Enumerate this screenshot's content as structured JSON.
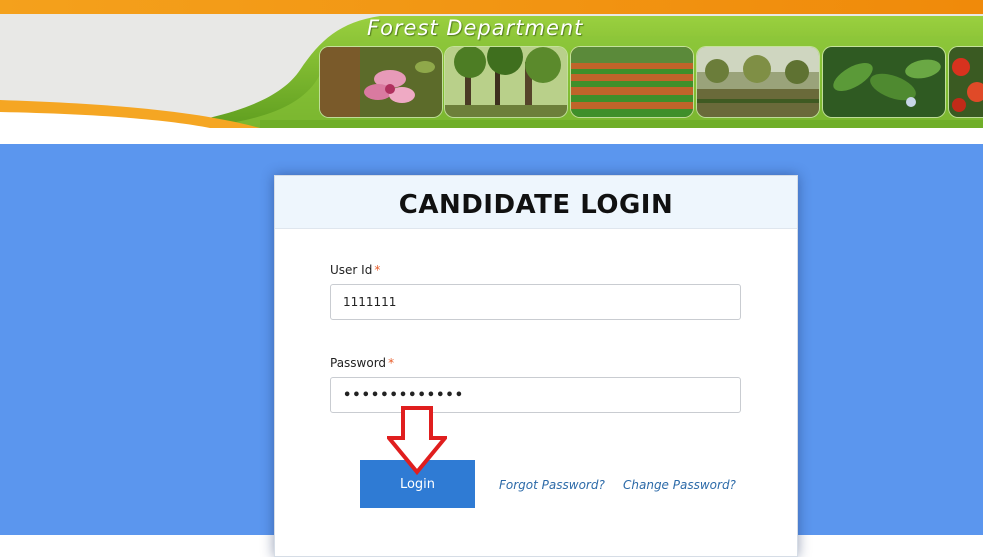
{
  "banner": {
    "title": "Forest Department"
  },
  "login": {
    "title": "CANDIDATE LOGIN",
    "user_id_label": "User Id",
    "user_id_value": "1111111",
    "password_label": "Password",
    "password_value": "•••••••••••••",
    "required_marker": "*",
    "login_button": "Login",
    "forgot_password": "Forgot Password?",
    "change_password": "Change Password?"
  },
  "icons": {
    "annotation_arrow": "down-arrow-icon"
  },
  "colors": {
    "background": "#5b96ee",
    "button": "#2f7bd4",
    "link": "#2c6aa8",
    "banner_green": "#7cbc32",
    "banner_orange": "#f39a12",
    "arrow": "#e01e1e"
  }
}
